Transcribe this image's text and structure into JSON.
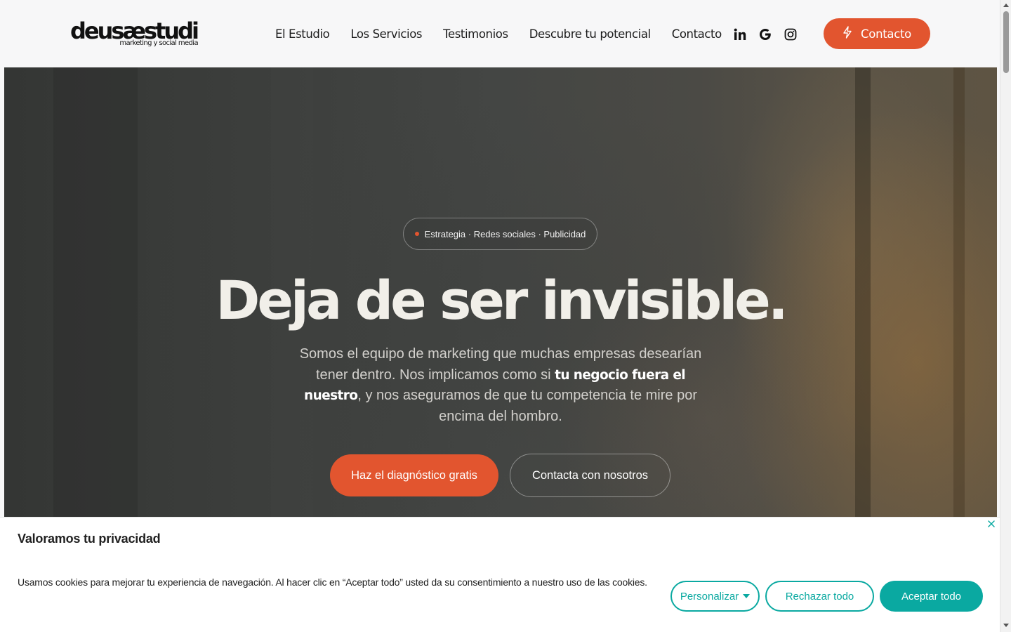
{
  "header": {
    "logo_text": "deusæstudi",
    "logo_subtitle": "marketing y social media",
    "nav": [
      {
        "label": "El Estudio"
      },
      {
        "label": "Los Servicios"
      },
      {
        "label": "Testimonios"
      },
      {
        "label": "Descubre tu potencial"
      },
      {
        "label": "Contacto"
      }
    ],
    "social_icons": [
      "linkedin-icon",
      "google-icon",
      "instagram-icon"
    ],
    "contact_button": "Contacto"
  },
  "hero": {
    "tagline": "Estrategia · Redes sociales · Publicidad",
    "title": "Deja de ser invisible.",
    "text_before": "Somos el equipo de marketing que muchas empresas desearían tener dentro. Nos implicamos como si ",
    "text_highlight": "tu negocio fuera el nuestro",
    "text_after": ", y nos aseguramos de que tu competencia te mire por encima del hombro.",
    "primary_button": "Haz el diagnóstico gratis",
    "secondary_button": "Contacta con nosotros"
  },
  "cookie_banner": {
    "title": "Valoramos tu privacidad",
    "text": "Usamos cookies para mejorar tu experiencia de navegación. Al hacer clic en “Aceptar todo” usted da su consentimiento a nuestro uso de las cookies.",
    "customize_button": "Personalizar",
    "reject_button": "Rechazar todo",
    "accept_button": "Aceptar todo"
  },
  "colors": {
    "accent": "#e2552f",
    "cookie_accent": "#0aa9a1",
    "hero_text": "#f1efe9"
  }
}
